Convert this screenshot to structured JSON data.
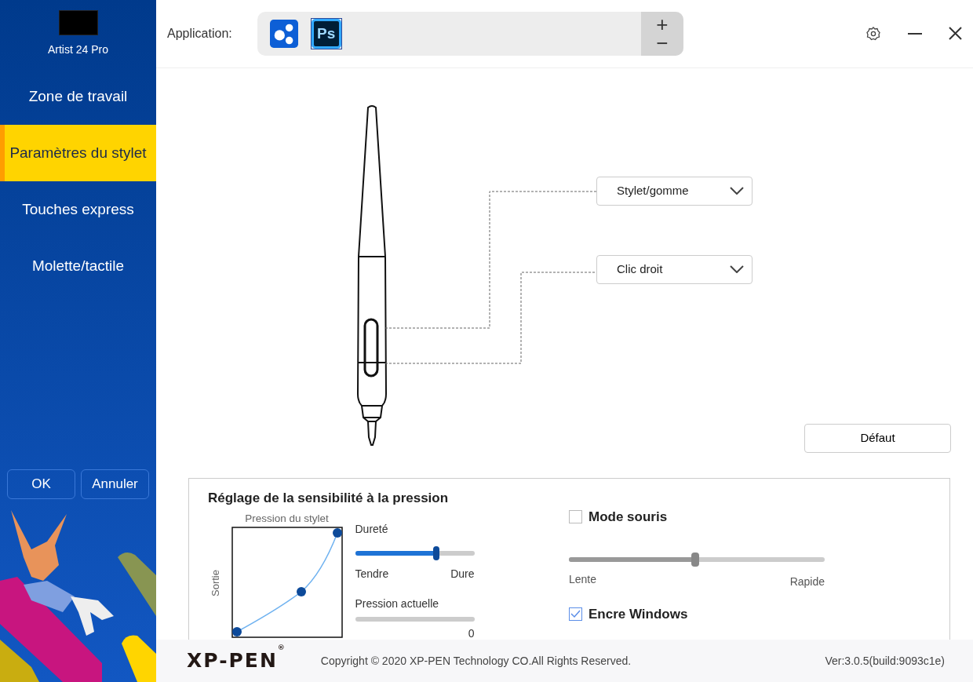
{
  "sidebar": {
    "device": {
      "name": "Artist 24 Pro"
    },
    "items": [
      {
        "label": "Zone de travail",
        "selected": false
      },
      {
        "label": "Paramètres du stylet",
        "selected": true
      },
      {
        "label": "Touches express",
        "selected": false
      },
      {
        "label": "Molette/tactile",
        "selected": false
      }
    ],
    "buttons": [
      "OK",
      "Annuler"
    ]
  },
  "header": {
    "label": "Application:",
    "apps": [
      {
        "kind": "generic",
        "selected": false
      },
      {
        "kind": "photoshop",
        "label": "Ps",
        "selected": true
      }
    ],
    "add": "+",
    "remove": "−"
  },
  "pen": {
    "buttons": [
      {
        "value": "Stylet/gomme"
      },
      {
        "value": "Clic droit"
      }
    ],
    "default_button": "Défaut"
  },
  "pressure": {
    "title": "Réglage de la sensibilité à la pression",
    "curve_title": "Pression du stylet",
    "curve_ylabel": "Sortie",
    "hardness": {
      "label": "Dureté",
      "level": 0.68,
      "min": "Tendre",
      "max": "Dure"
    },
    "current": {
      "label": "Pression actuelle",
      "level": 0,
      "reading": "0"
    },
    "mouse_mode": {
      "label": "Mode souris",
      "checked": false
    },
    "speed": {
      "level": 0.49,
      "min": "Lente",
      "max": "Rapide"
    },
    "windows_ink": {
      "label": "Encre Windows",
      "checked": true
    }
  },
  "footer": {
    "logo": "XP-PEN",
    "logo_mark": "®",
    "copyright": "Copyright © 2020 XP-PEN Technology CO.All Rights Reserved.",
    "version": "Ver:3.0.5(build:9093c1e)"
  }
}
